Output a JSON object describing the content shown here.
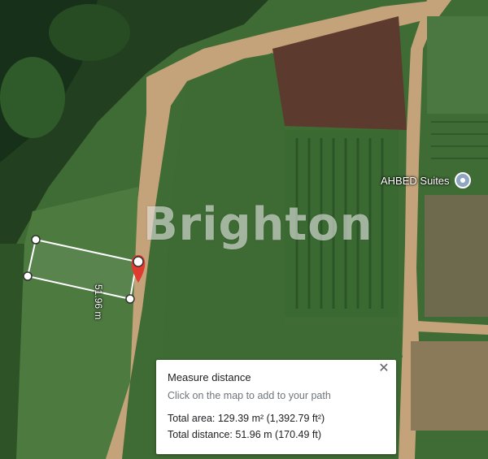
{
  "map": {
    "watermark": "Brighton",
    "poi": {
      "label": "AHBED Suites",
      "icon": "location-pin-icon"
    },
    "measure_label": "51.96 m",
    "colors": {
      "road": "#c9a87c",
      "field": "#3e6a33",
      "dark_trees": "#1f3a1c",
      "soil": "#5a3a2c",
      "pin": "#e03b2f"
    }
  },
  "panel": {
    "title": "Measure distance",
    "hint": "Click on the map to add to your path",
    "area_label": "Total area:",
    "area_value": "129.39 m² (1,392.79 ft²)",
    "distance_label": "Total distance:",
    "distance_value": "51.96 m (170.49 ft)",
    "close_icon": "close-icon"
  }
}
